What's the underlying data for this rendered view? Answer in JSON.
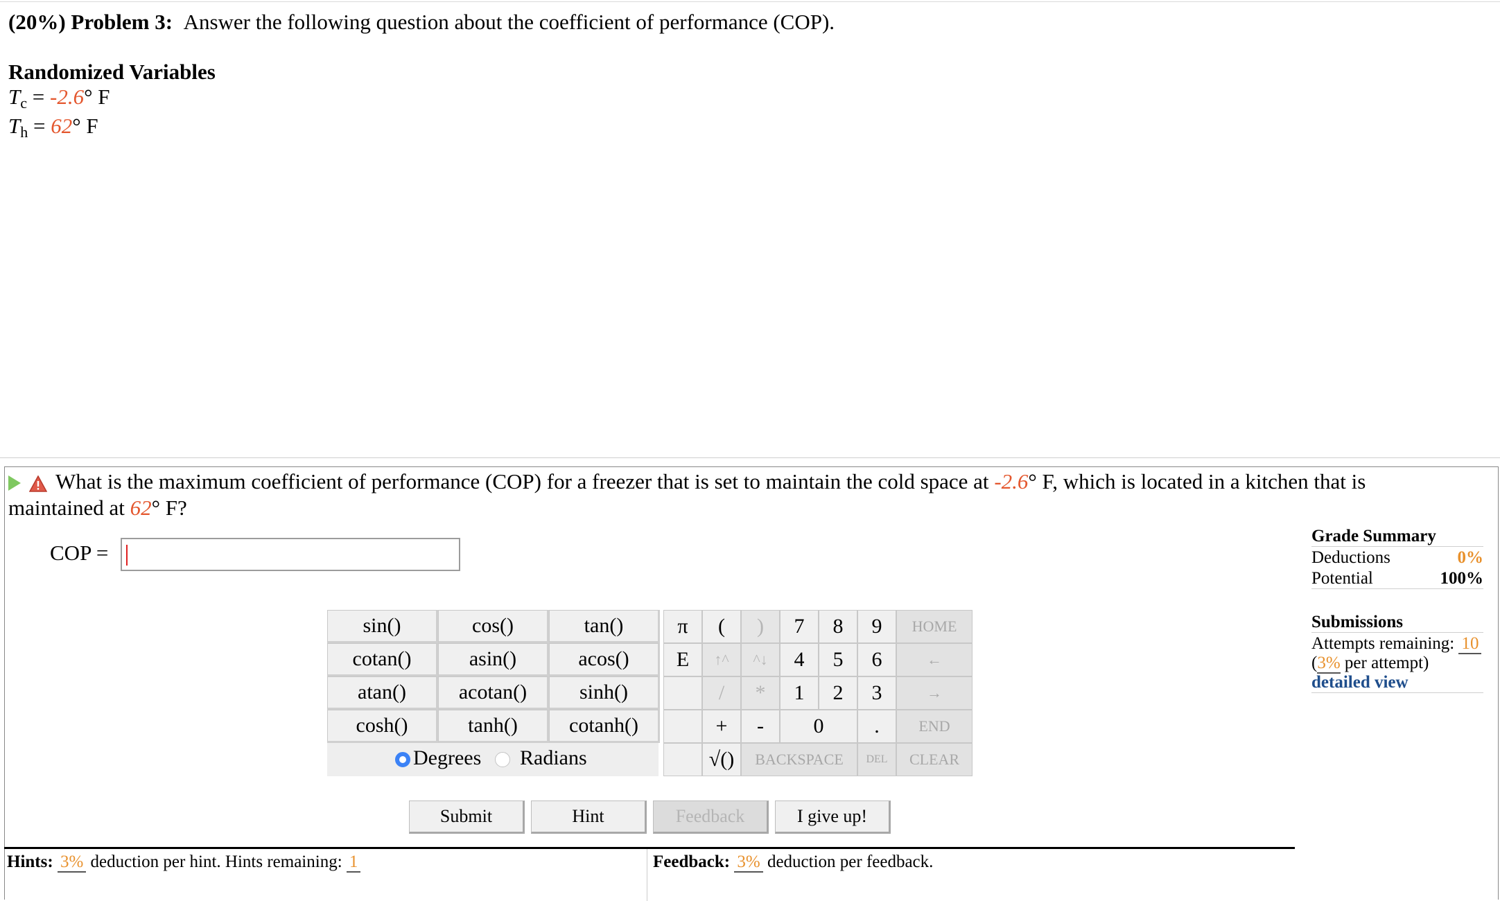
{
  "problem": {
    "weight": "(20%)",
    "label": "Problem 3:",
    "prompt": "Answer the following question about the coefficient of performance (COP)."
  },
  "randomized": {
    "title": "Randomized Variables",
    "tc": {
      "symbol": "T",
      "sub": "c",
      "eq": " = ",
      "value": "-2.6",
      "unit": "° F"
    },
    "th": {
      "symbol": "T",
      "sub": "h",
      "eq": " = ",
      "value": "62",
      "unit": "° F"
    }
  },
  "question": {
    "part1": "What is the maximum coefficient of performance (COP) for a freezer that is set to maintain the cold space at ",
    "val1": "-2.6",
    "part2": "° F, which is located in a kitchen that is maintained at ",
    "val2": "62",
    "part3": "° F?"
  },
  "answer": {
    "label": "COP =",
    "value": ""
  },
  "keypad": {
    "functions": [
      [
        "sin()",
        "cos()",
        "tan()"
      ],
      [
        "cotan()",
        "asin()",
        "acos()"
      ],
      [
        "atan()",
        "acotan()",
        "sinh()"
      ],
      [
        "cosh()",
        "tanh()",
        "cotanh()"
      ]
    ],
    "symbols": [
      "π",
      "(",
      ")",
      "E",
      "↑^",
      "^↓",
      "",
      "/",
      "*",
      "",
      "+",
      "-",
      "",
      "√()"
    ],
    "digits": [
      "7",
      "8",
      "9",
      "4",
      "5",
      "6",
      "1",
      "2",
      "3",
      "0",
      "."
    ],
    "nav": [
      "HOME",
      "←",
      "→",
      "END"
    ],
    "bottom": {
      "backspace": "BACKSPACE",
      "del": "DEL",
      "clear": "CLEAR"
    },
    "degrees": "Degrees",
    "radians": "Radians"
  },
  "buttons": {
    "submit": "Submit",
    "hint": "Hint",
    "feedback": "Feedback",
    "giveup": "I give up!"
  },
  "grade": {
    "title": "Grade Summary",
    "deductions_label": "Deductions",
    "deductions_value": "0%",
    "potential_label": "Potential",
    "potential_value": "100%"
  },
  "submissions": {
    "title": "Submissions",
    "attempts_label": "Attempts remaining:",
    "attempts_value": "10",
    "per_open": "(",
    "per_value": "3%",
    "per_text": " per attempt)",
    "detailed": "detailed view"
  },
  "hints": {
    "label": "Hints:",
    "pct": "3%",
    "text": " deduction per hint. Hints remaining:",
    "remaining": "1"
  },
  "feedback": {
    "label": "Feedback:",
    "pct": "3%",
    "text": " deduction per feedback."
  },
  "colors": {
    "accent_red": "#e4572e",
    "accent_orange": "#e8912d",
    "link_blue": "#1f4e8c",
    "radio_blue": "#3b82f6"
  }
}
